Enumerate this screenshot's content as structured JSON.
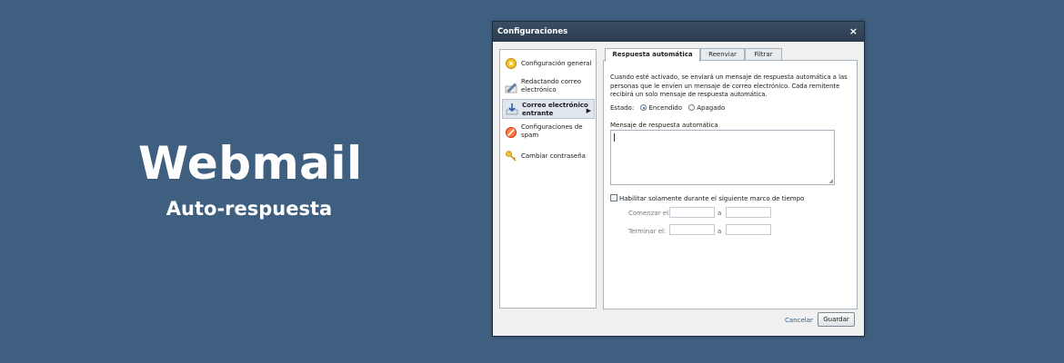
{
  "hero": {
    "title": "Webmail",
    "subtitle": "Auto-respuesta"
  },
  "dialog": {
    "title": "Configuraciones",
    "close": "×",
    "sidebar": {
      "items": [
        {
          "label": "Configuración general",
          "icon": "gear-icon",
          "active": false
        },
        {
          "label": "Redactando correo electrónico",
          "icon": "pencil-icon",
          "active": false
        },
        {
          "label": "Correo electrónico entrante",
          "icon": "inbox-arrow-icon",
          "active": true
        },
        {
          "label": "Configuraciones de spam",
          "icon": "no-spam-icon",
          "active": false
        },
        {
          "label": "Cambiar contraseña",
          "icon": "key-icon",
          "active": false
        }
      ],
      "active_arrow": "▶"
    },
    "tabs": [
      {
        "label": "Respuesta automática",
        "active": true
      },
      {
        "label": "Reenviar",
        "active": false
      },
      {
        "label": "Filtrar",
        "active": false
      }
    ],
    "description": "Cuando esté activado, se enviará un mensaje de respuesta automática a las personas que le envíen un mensaje de correo electrónico. Cada remitente recibirá un solo mensaje de respuesta automática.",
    "state": {
      "label": "Estado:",
      "options": [
        {
          "label": "Encendido",
          "selected": true
        },
        {
          "label": "Apagado",
          "selected": false
        }
      ]
    },
    "message_label": "Mensaje de respuesta automática",
    "message_value": "",
    "timeframe": {
      "checkbox_label": "Habilitar solamente durante el siguiente marco de tiempo",
      "checked": false,
      "start_label": "Comenzar el:",
      "end_label": "Terminar el:",
      "separator": "a"
    },
    "footer": {
      "cancel": "Cancelar",
      "save": "Guardar"
    }
  },
  "colors": {
    "background": "#3f5f80",
    "titlebar": "#2f4154",
    "link": "#2d5f9a"
  }
}
